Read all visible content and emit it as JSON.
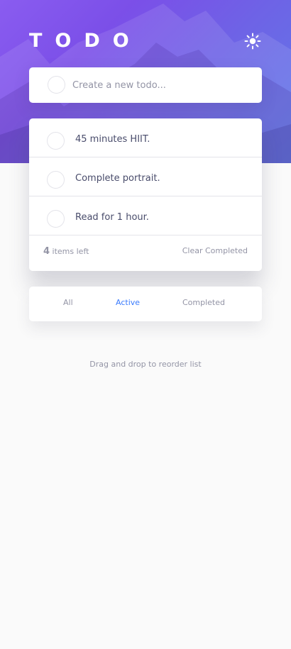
{
  "header": {
    "title": "TODO",
    "theme_toggle_icon": "sun-icon"
  },
  "new_todo": {
    "placeholder": "Create a new todo..."
  },
  "todos": [
    {
      "label": "45 minutes HIIT.",
      "completed": false
    },
    {
      "label": "Complete portrait.",
      "completed": false
    },
    {
      "label": "Read for 1 hour.",
      "completed": false
    }
  ],
  "footer": {
    "count": "4",
    "items_left_label": "items left",
    "clear_completed_label": "Clear Completed"
  },
  "filters": {
    "all": "All",
    "active": "Active",
    "completed": "Completed",
    "selected": "Active"
  },
  "hint": "Drag and drop to reorder list",
  "colors": {
    "accent": "#3a7bfd",
    "background": "#fafafa",
    "gradient_start": "#8a5cf0",
    "gradient_end": "#5f7be8"
  }
}
